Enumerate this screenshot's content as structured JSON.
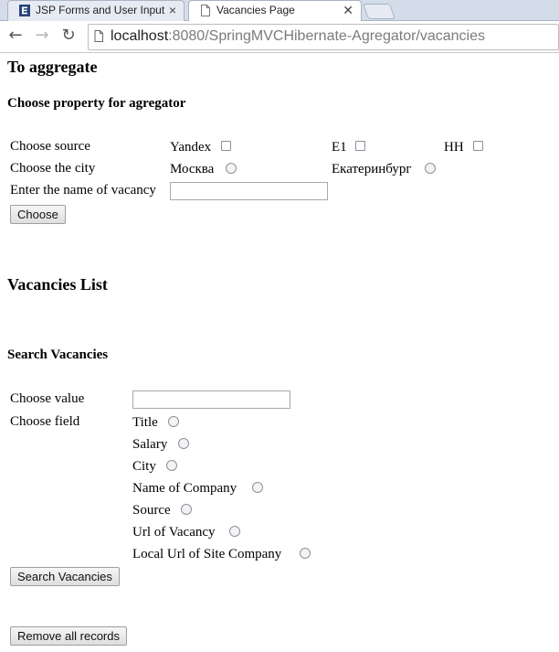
{
  "browser": {
    "tabs": [
      {
        "title": "JSP Forms and User Input",
        "favicon": "e-icon",
        "active": false
      },
      {
        "title": "Vacancies Page",
        "favicon": "page-icon",
        "active": true
      }
    ],
    "url_host": "localhost",
    "url_path": ":8080/SpringMVCHibernate-Agregator/vacancies"
  },
  "aggregate": {
    "heading": "To aggregate",
    "subheading": "Choose property for agregator",
    "source_label": "Choose source",
    "sources": [
      "Yandex",
      "E1",
      "HH"
    ],
    "city_label": "Choose the city",
    "cities": [
      "Москва",
      "Екатеринбург"
    ],
    "vacancy_label": "Enter the name of vacancy",
    "vacancy_value": "",
    "choose_button": "Choose"
  },
  "vacancies_list": {
    "heading": "Vacancies List"
  },
  "search": {
    "heading": "Search Vacancies",
    "value_label": "Choose value",
    "value_input": "",
    "field_label": "Choose field",
    "fields": [
      "Title",
      "Salary",
      "City",
      "Name of Company",
      "Source",
      "Url of Vacancy",
      "Local Url of Site Company"
    ],
    "search_button": "Search Vacancies"
  },
  "remove_button": "Remove all records"
}
